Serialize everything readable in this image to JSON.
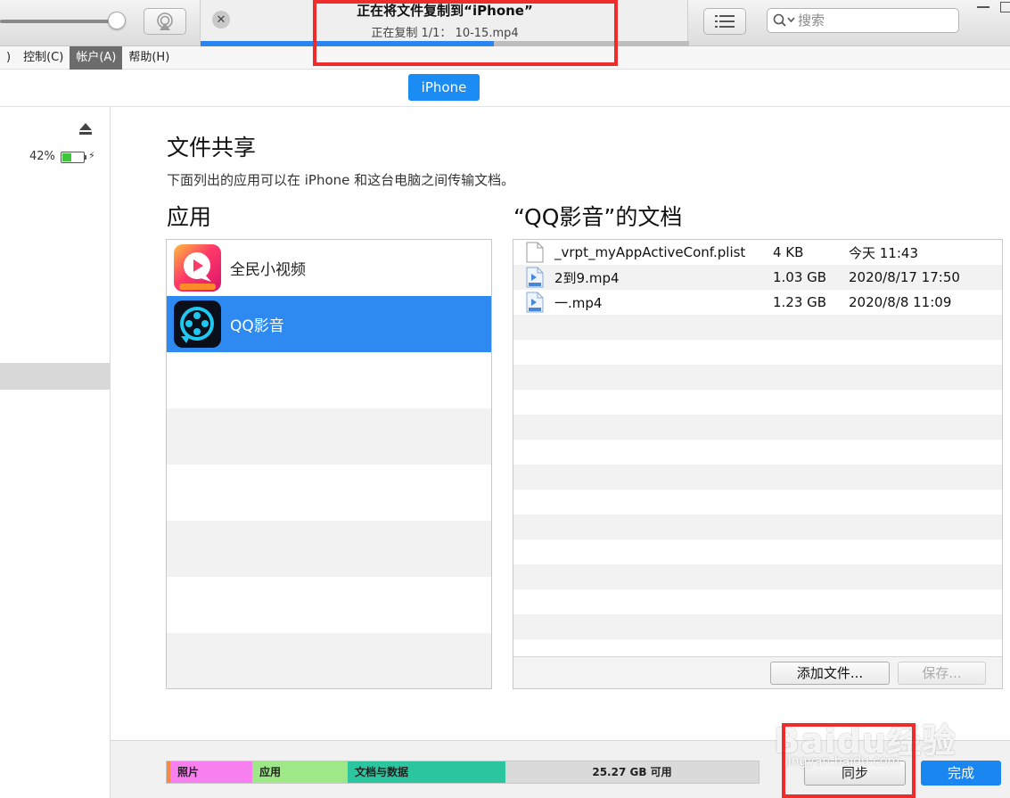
{
  "toolbar": {
    "volume_level": 0.88,
    "transfer_title": "正在将文件复制到“iPhone”",
    "transfer_status": "正在复制 1/1： 10-15.mp4",
    "transfer_progress": 0.6,
    "close_glyph": "✕",
    "search_placeholder": "搜索"
  },
  "menu": {
    "items": [
      ")",
      "控制(C)",
      "帐户(A)",
      "帮助(H)"
    ],
    "active_index": 2
  },
  "device": {
    "name": "iPhone"
  },
  "sidebar": {
    "battery_percent": "42%",
    "battery_level": 0.42,
    "charging_glyph": "⚡"
  },
  "main": {
    "title": "文件共享",
    "description": "下面列出的应用可以在 iPhone 和这台电脑之间传输文档。",
    "apps_heading": "应用",
    "docs_heading": "“QQ影音”的文档",
    "apps": [
      {
        "name": "全民小视频",
        "icon": "quanmin-video-app-icon",
        "selected": false
      },
      {
        "name": "QQ影音",
        "icon": "qq-player-app-icon",
        "selected": true
      }
    ],
    "documents": [
      {
        "name": "_vrpt_myAppActiveConf.plist",
        "size": "4 KB",
        "date": "今天 11:43",
        "icon": "plist-file-icon"
      },
      {
        "name": "2到9.mp4",
        "size": "1.03 GB",
        "date": "2020/8/17 17:50",
        "icon": "mp4-file-icon"
      },
      {
        "name": "一.mp4",
        "size": "1.23 GB",
        "date": "2020/8/8 11:09",
        "icon": "mp4-file-icon"
      }
    ],
    "add_file_label": "添加文件...",
    "save_label": "保存..."
  },
  "storage": {
    "photos_label": "照片",
    "apps_label": "应用",
    "docs_label": "文档与数据",
    "free_label": "25.27 GB 可用"
  },
  "footer": {
    "sync_label": "同步",
    "done_label": "完成"
  },
  "watermark": {
    "logo_text": "Baidu经验",
    "url_text": "jingyan.baidu.com"
  },
  "colors": {
    "accent": "#1a8cf4",
    "selection": "#2e8af0",
    "highlight_box": "#f02b2b",
    "photos": "#f87ff0",
    "apps": "#9ee887",
    "docs": "#2bc59f"
  }
}
